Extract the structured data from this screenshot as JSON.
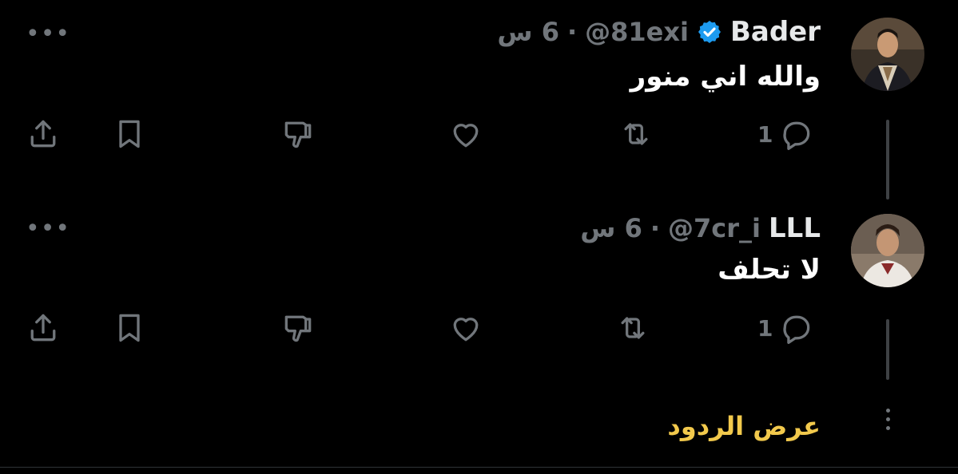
{
  "tweets": [
    {
      "name": "Bader",
      "handle": "@81exi",
      "separator": "·",
      "time": "6 س",
      "verified": true,
      "text": "والله اني منور",
      "more_label": "•••",
      "actions": {
        "reply_count": "1"
      }
    },
    {
      "name": "LLL",
      "handle": "@7cr_i",
      "separator": "·",
      "time": "6 س",
      "verified": false,
      "text": "لا تحلف",
      "more_label": "•••",
      "actions": {
        "reply_count": "1"
      }
    }
  ],
  "show_replies_label": "عرض الردود",
  "colors": {
    "background": "#000000",
    "muted": "#71767b",
    "verified": "#1d9bf0",
    "show_replies": "#f2c94c",
    "thread_line": "#3e4144"
  },
  "icons": [
    "share-icon",
    "bookmark-icon",
    "dislike-icon",
    "like-icon",
    "retweet-icon",
    "reply-icon",
    "verified-icon",
    "more-icon"
  ]
}
